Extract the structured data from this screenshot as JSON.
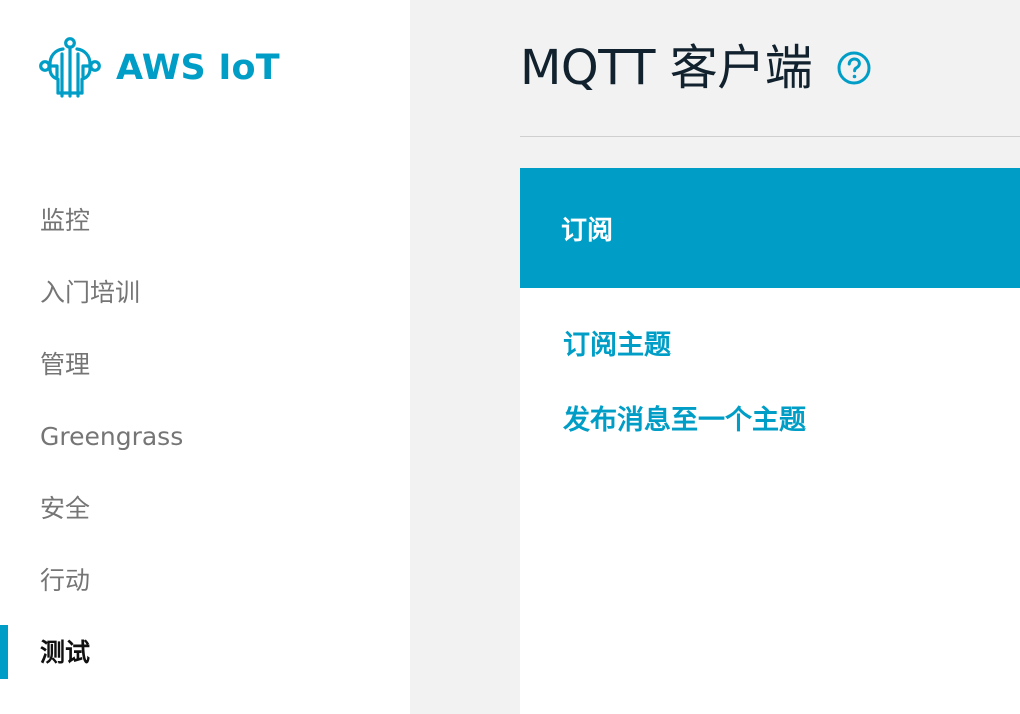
{
  "brand": {
    "name": "AWS IoT",
    "logo_icon": "aws-iot-brain-icon",
    "color": "#009EC6"
  },
  "sidebar": {
    "items": [
      {
        "label": "监控"
      },
      {
        "label": "入门培训"
      },
      {
        "label": "管理"
      },
      {
        "label": "Greengrass"
      },
      {
        "label": "安全"
      },
      {
        "label": "行动"
      },
      {
        "label": "测试",
        "active": true
      }
    ]
  },
  "header": {
    "title": "MQTT 客户端",
    "help_icon": "help-circle-icon"
  },
  "panel": {
    "title": "订阅",
    "links": [
      {
        "label": "订阅主题"
      },
      {
        "label": "发布消息至一个主题"
      }
    ]
  },
  "colors": {
    "accent": "#009EC6",
    "sidebar_background": "#FFFFFF",
    "main_background": "#F2F2F2",
    "text_dark": "#11222E",
    "text_muted": "#757575"
  }
}
